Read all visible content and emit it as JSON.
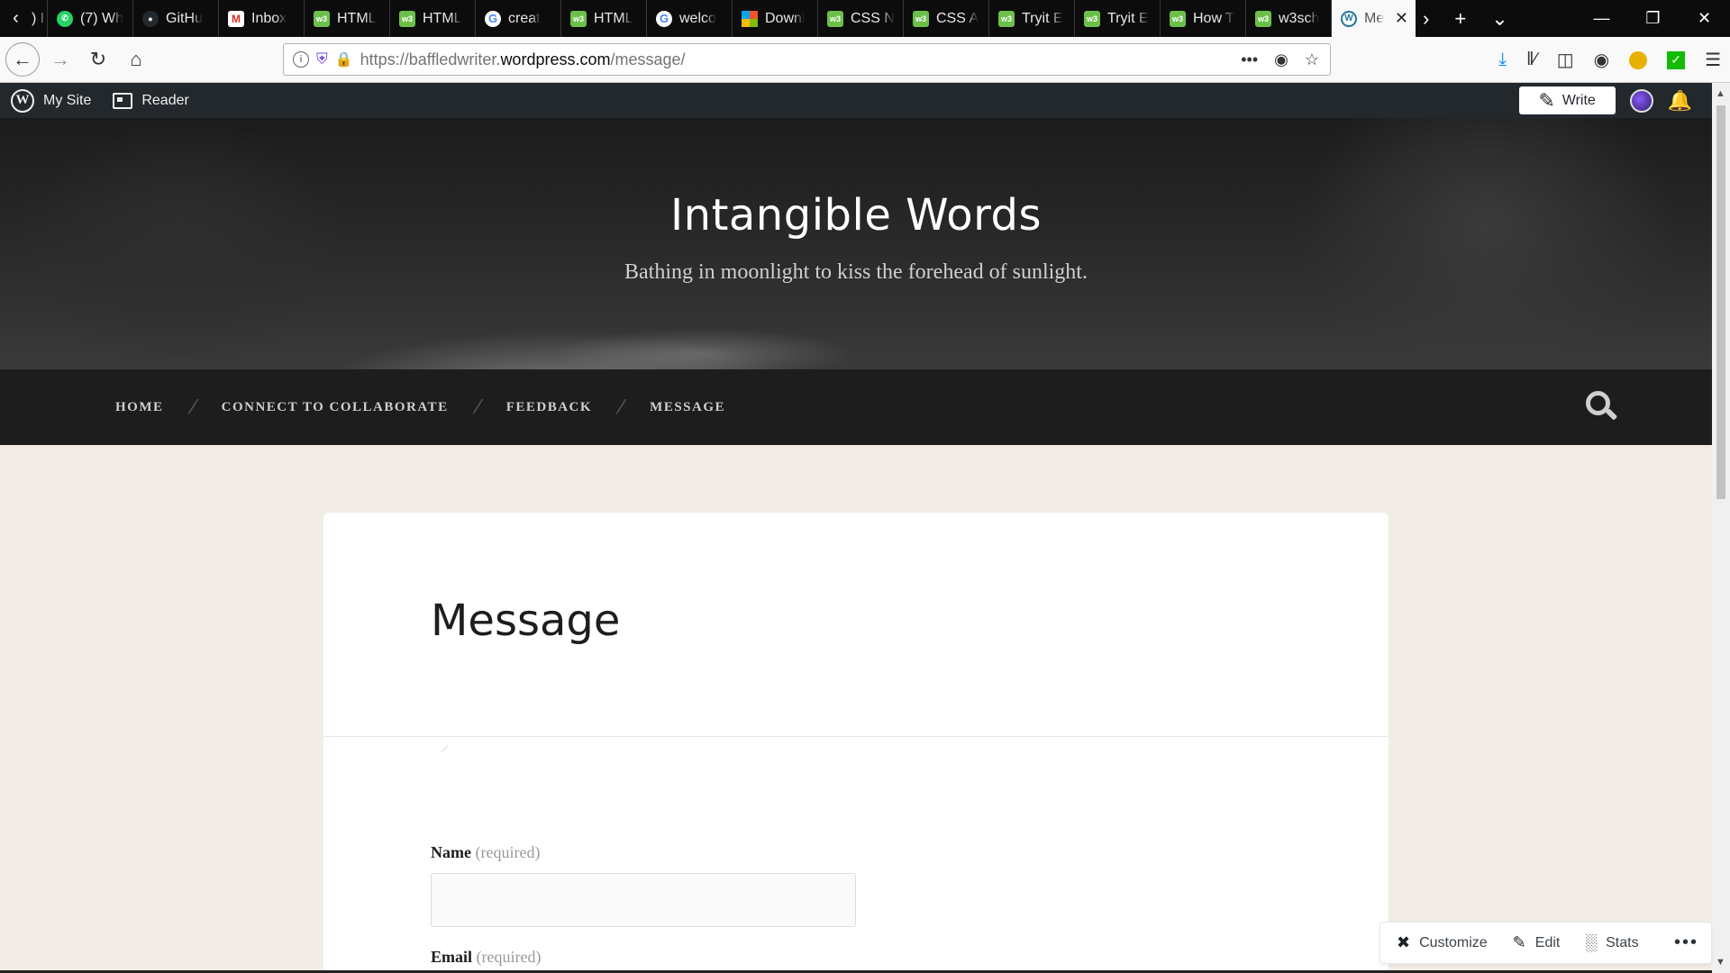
{
  "browser": {
    "tabs": [
      {
        "label": ") I",
        "favicon": "generic"
      },
      {
        "label": "(7) Wh",
        "favicon": "whatsapp"
      },
      {
        "label": "GitHu",
        "favicon": "github"
      },
      {
        "label": "Inbox",
        "favicon": "gmail"
      },
      {
        "label": "HTML",
        "favicon": "w3schools"
      },
      {
        "label": "HTML",
        "favicon": "w3schools"
      },
      {
        "label": "creat",
        "favicon": "google"
      },
      {
        "label": "HTML",
        "favicon": "w3schools"
      },
      {
        "label": "welco",
        "favicon": "google"
      },
      {
        "label": "Downl",
        "favicon": "microsoft"
      },
      {
        "label": "CSS N",
        "favicon": "w3schools"
      },
      {
        "label": "CSS A",
        "favicon": "w3schools"
      },
      {
        "label": "Tryit E",
        "favicon": "w3schools"
      },
      {
        "label": "Tryit E",
        "favicon": "w3schools"
      },
      {
        "label": "How T",
        "favicon": "w3schools"
      },
      {
        "label": "w3sch",
        "favicon": "w3schools"
      }
    ],
    "active_tab": {
      "label": "Me",
      "favicon": "wordpress"
    },
    "url": {
      "prefix": "https://baffledwriter.",
      "host": "wordpress.com",
      "path": "/message/"
    }
  },
  "wp_admin_bar": {
    "my_site": "My Site",
    "reader": "Reader",
    "write": "Write"
  },
  "site": {
    "title": "Intangible Words",
    "tagline": "Bathing in moonlight to kiss the forehead of sunlight."
  },
  "menu": {
    "items": [
      "Home",
      "Connect to Collaborate",
      "Feedback",
      "Message"
    ],
    "separator": "/"
  },
  "page": {
    "title": "Message",
    "fields": {
      "name_label": "Name",
      "email_label": "Email",
      "required_note": "(required)",
      "name_value": ""
    }
  },
  "action_bar": {
    "customize": "Customize",
    "edit": "Edit",
    "stats": "Stats"
  }
}
